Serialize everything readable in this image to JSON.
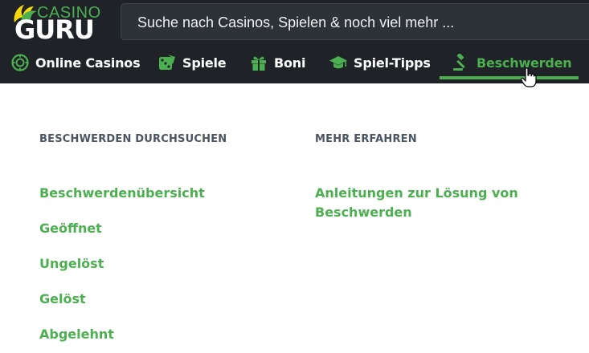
{
  "logo": {
    "top_text": "CASINO",
    "bottom_text": "GURU"
  },
  "search": {
    "placeholder": "Suche nach Casinos, Spielen & noch viel mehr ..."
  },
  "nav": {
    "items": [
      {
        "label": "Online Casinos",
        "icon": "casino-chip-icon"
      },
      {
        "label": "Spiele",
        "icon": "dice-icon"
      },
      {
        "label": "Boni",
        "icon": "gift-icon"
      },
      {
        "label": "Spiel-Tipps",
        "icon": "graduation-cap-icon"
      },
      {
        "label": "Beschwerden",
        "icon": "gavel-icon",
        "active": true
      }
    ]
  },
  "dropdown": {
    "left": {
      "heading": "BESCHWERDEN DURCHSUCHEN",
      "links": [
        "Beschwerdenübersicht",
        "Geöffnet",
        "Ungelöst",
        "Gelöst",
        "Abgelehnt"
      ]
    },
    "right": {
      "heading": "MEHR ERFAHREN",
      "links": [
        "Anleitungen zur Lösung von Beschwerden"
      ]
    }
  },
  "colors": {
    "accent": "#4caf50",
    "header_bg": "#1f2328",
    "heading": "#4a5563"
  }
}
